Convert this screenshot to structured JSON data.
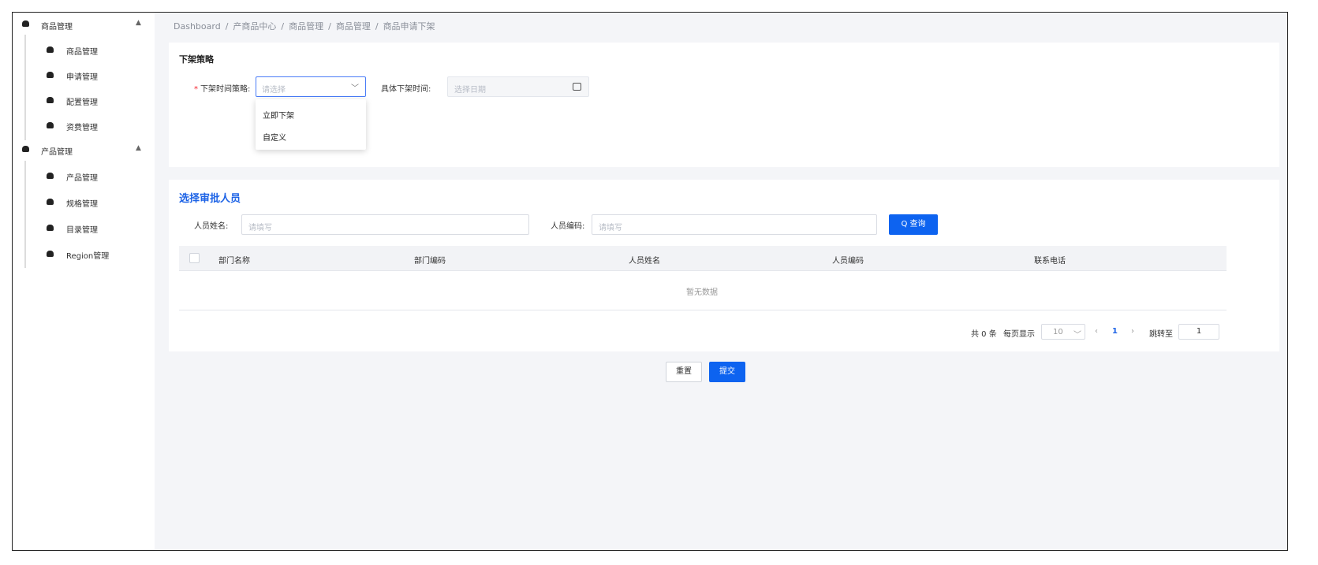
{
  "sidebar": {
    "groups": [
      {
        "label": "商品管理",
        "items": [
          "商品管理",
          "申请管理",
          "配置管理",
          "资费管理"
        ]
      },
      {
        "label": "产品管理",
        "items": [
          "产品管理",
          "规格管理",
          "目录管理",
          "Region管理"
        ]
      }
    ]
  },
  "breadcrumb": [
    "Dashboard",
    "产商品中心",
    "商品管理",
    "商品管理",
    "商品申请下架"
  ],
  "strategy": {
    "title": "下架策略",
    "time_strategy_label": "下架时间策略:",
    "time_strategy_placeholder": "请选择",
    "specific_time_label": "具体下架时间:",
    "specific_time_placeholder": "选择日期",
    "options": [
      "立即下架",
      "自定义"
    ]
  },
  "approver": {
    "title": "选择审批人员",
    "name_label": "人员姓名:",
    "name_placeholder": "请填写",
    "code_label": "人员编码:",
    "code_placeholder": "请填写",
    "search_button": "Q 查询",
    "columns": [
      "部门名称",
      "部门编码",
      "人员姓名",
      "人员编码",
      "联系电话"
    ],
    "empty_text": "暂无数据",
    "pagination": {
      "total": "共 0 条",
      "page_size_label": "每页显示",
      "page_size": "10",
      "current_page": "1",
      "jump_label": "跳转至",
      "jump_value": "1"
    }
  },
  "actions": {
    "reset": "重置",
    "submit": "提交"
  }
}
